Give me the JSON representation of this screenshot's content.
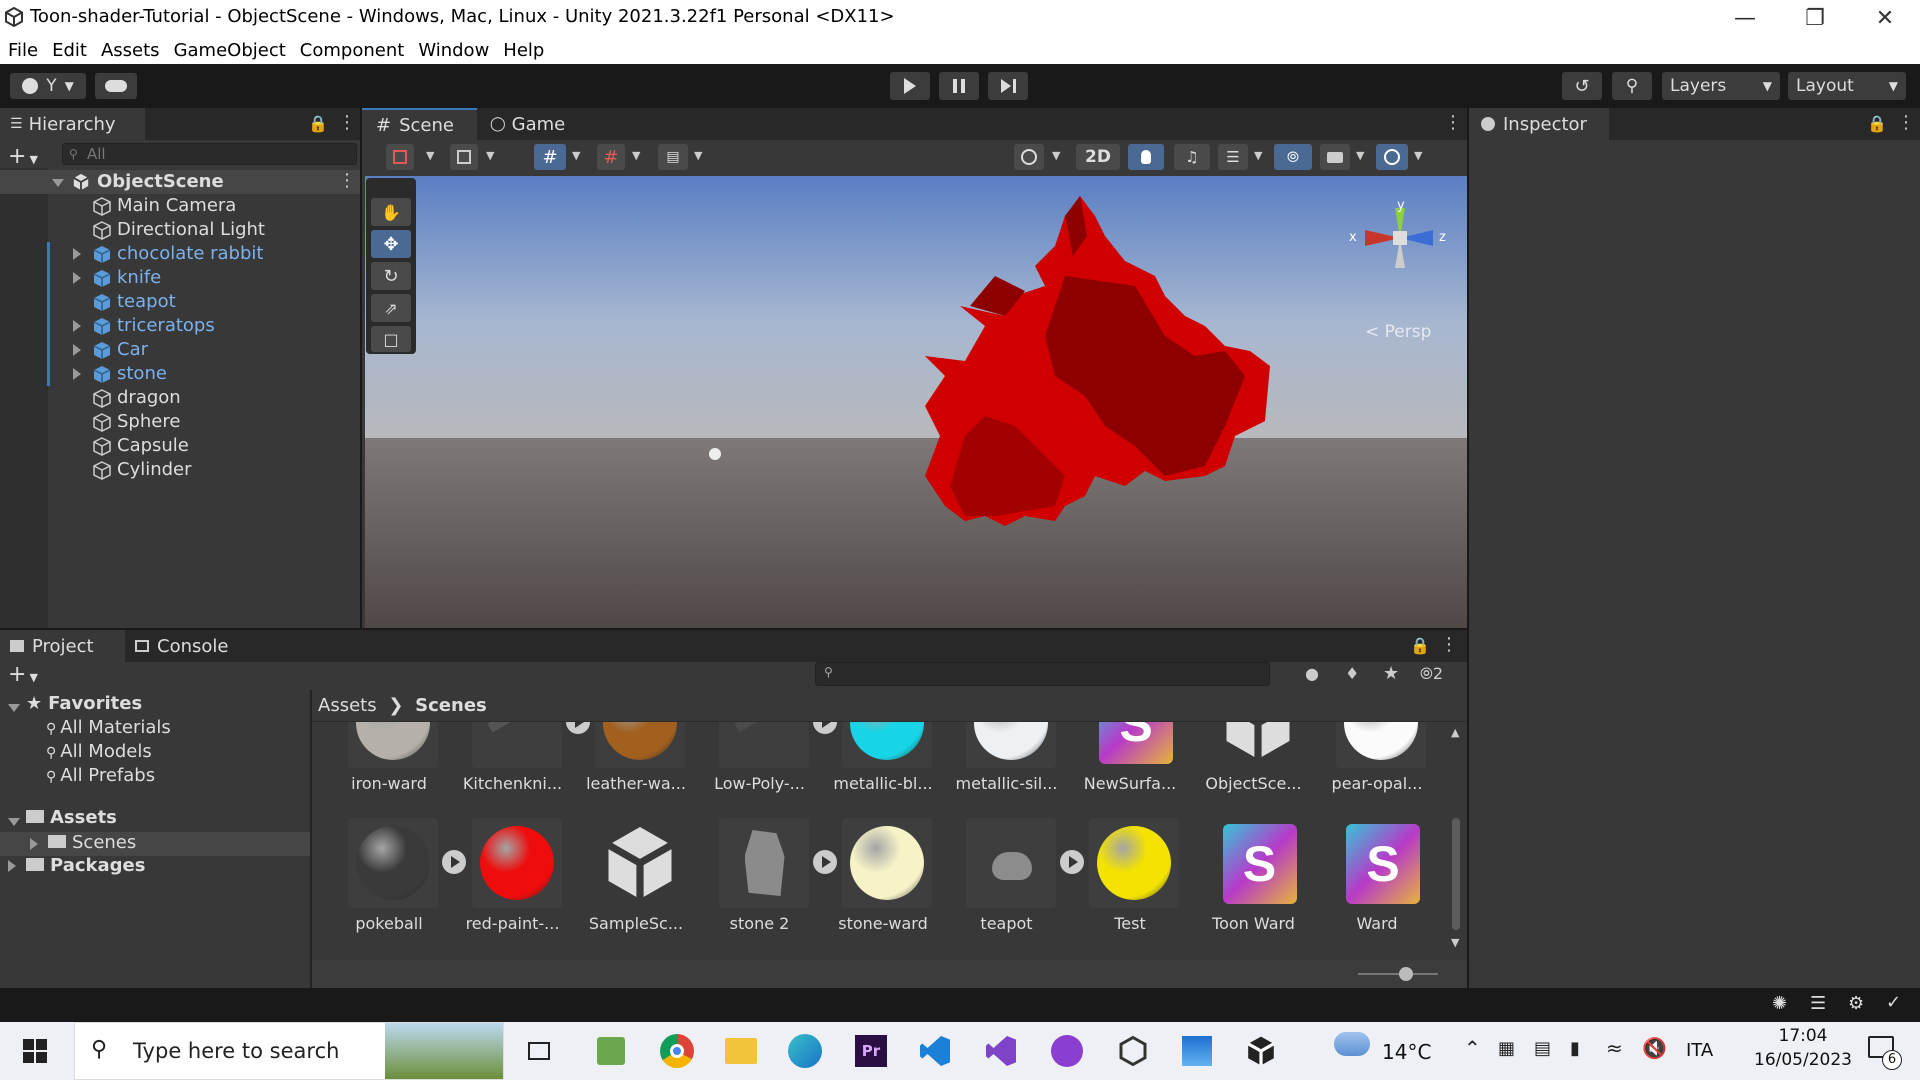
{
  "window": {
    "title": "Toon-shader-Tutorial - ObjectScene - Windows, Mac, Linux - Unity 2021.3.22f1 Personal <DX11>",
    "minimize_icon": "minimize-icon",
    "maximize_icon": "restore-icon",
    "close_icon": "close-icon"
  },
  "menu": [
    "File",
    "Edit",
    "Assets",
    "GameObject",
    "Component",
    "Window",
    "Help"
  ],
  "toolbar": {
    "account_label": "Y",
    "layers_label": "Layers",
    "layout_label": "Layout"
  },
  "hierarchy": {
    "tab_label": "Hierarchy",
    "search_placeholder": "All",
    "scene_name": "ObjectScene",
    "items": [
      {
        "label": "Main Camera",
        "prefab": false,
        "expandable": false
      },
      {
        "label": "Directional Light",
        "prefab": false,
        "expandable": false
      },
      {
        "label": "chocolate rabbit",
        "prefab": true,
        "expandable": true
      },
      {
        "label": "knife",
        "prefab": true,
        "expandable": true
      },
      {
        "label": "teapot",
        "prefab": true,
        "expandable": false
      },
      {
        "label": "triceratops",
        "prefab": true,
        "expandable": true
      },
      {
        "label": "Car",
        "prefab": true,
        "expandable": true
      },
      {
        "label": "stone",
        "prefab": true,
        "expandable": true
      },
      {
        "label": "dragon",
        "prefab": false,
        "expandable": false
      },
      {
        "label": "Sphere",
        "prefab": false,
        "expandable": false
      },
      {
        "label": "Capsule",
        "prefab": false,
        "expandable": false
      },
      {
        "label": "Cylinder",
        "prefab": false,
        "expandable": false
      }
    ]
  },
  "scene_view": {
    "tab_scene": "Scene",
    "tab_game": "Game",
    "btn_2d": "2D",
    "gizmo_persp": "Persp",
    "gizmo_x": "x",
    "gizmo_y": "y",
    "gizmo_z": "z"
  },
  "inspector": {
    "tab_label": "Inspector"
  },
  "project": {
    "tab_project": "Project",
    "tab_console": "Console",
    "favorites_label": "Favorites",
    "favorites": [
      "All Materials",
      "All Models",
      "All Prefabs"
    ],
    "assets_label": "Assets",
    "scenes_label": "Scenes",
    "packages_label": "Packages",
    "breadcrumb_root": "Assets",
    "breadcrumb_current": "Scenes",
    "hidden_count": "2",
    "row1": [
      "iron-ward",
      "Kitchenkni...",
      "leather-wa...",
      "Low-Poly-...",
      "metallic-bl...",
      "metallic-sil...",
      "NewSurfa...",
      "ObjectSce...",
      "pear-opal..."
    ],
    "row2": [
      "pokeball",
      "red-paint-...",
      "SampleSc...",
      "stone 2",
      "stone-ward",
      "teapot",
      "Test",
      "Toon Ward",
      "Ward"
    ]
  },
  "taskbar": {
    "search_placeholder": "Type here to search",
    "weather": "14°C",
    "language": "ITA",
    "time": "17:04",
    "date": "16/05/2023",
    "notifications": "6"
  }
}
